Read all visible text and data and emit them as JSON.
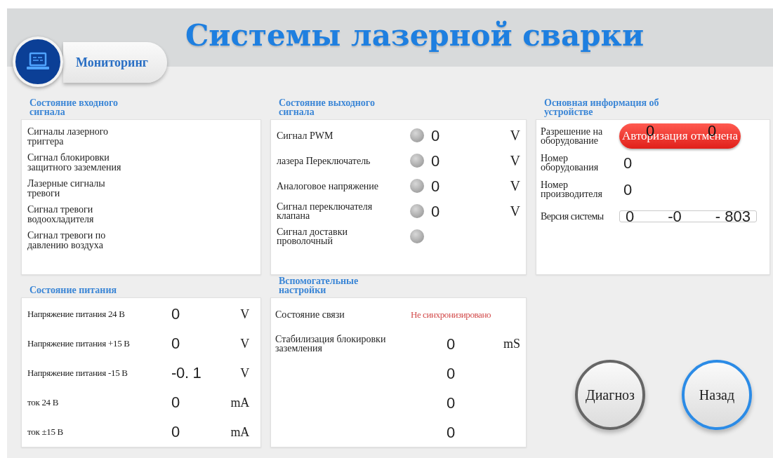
{
  "title": "Системы лазерной сварки",
  "nav": {
    "label": "Мониторинг",
    "selected": true
  },
  "input_signals": {
    "heading": "Состояние входного сигнала",
    "rows": [
      {
        "label": "Сигналы лазерного триггера"
      },
      {
        "label": "Сигнал блокировки защитного заземления"
      },
      {
        "label": "Лазерные сигналы тревоги"
      },
      {
        "label": "Сигнал тревоги водоохладителя"
      },
      {
        "label": "Сигнал тревоги по давлению воздуха"
      }
    ]
  },
  "output_signals": {
    "heading": "Состояние выходного сигнала",
    "rows": [
      {
        "label": "Сигнал PWM",
        "on": false,
        "value": "0",
        "unit": "V"
      },
      {
        "label": "лазера Переключатель",
        "on": false,
        "value": "0",
        "unit": "V"
      },
      {
        "label": "Аналоговое напряжение",
        "on": false,
        "value": "0",
        "unit": "V"
      },
      {
        "label": "Сигнал переключателя клапана",
        "on": false,
        "value": "0",
        "unit": "V"
      },
      {
        "label": "Сигнал доставки проволочный",
        "on": false
      }
    ]
  },
  "device_info": {
    "heading": "Основная информация об устройстве",
    "authorization": {
      "label": "Разрешение на оборудование",
      "button": "Авторизация отменена",
      "overlay": [
        "0",
        "0"
      ]
    },
    "equipment_number": {
      "label": "Номер оборудования",
      "value": "0"
    },
    "manufacturer_number": {
      "label": "Номер производителя",
      "value": "0"
    },
    "system_version": {
      "label": "Версия системы",
      "parts": [
        "0",
        "-0",
        "- 803"
      ]
    }
  },
  "power": {
    "heading": "Состояние питания",
    "rows": [
      {
        "label": "Напряжение питания 24 В",
        "value": "0",
        "unit": "V"
      },
      {
        "label": "Напряжение питания +15 В",
        "value": "0",
        "unit": "V"
      },
      {
        "label": "Напряжение питания -15 В",
        "value": "-0. 1",
        "unit": "V"
      },
      {
        "label": "ток 24 В",
        "value": "0",
        "unit": "mA"
      },
      {
        "label": "ток ±15 В",
        "value": "0",
        "unit": "mA"
      }
    ]
  },
  "aux": {
    "heading": "Вспомогательные настройки",
    "rows": [
      {
        "kind": "status",
        "label": "Состояние связи",
        "value": "Не синхронизировано"
      },
      {
        "kind": "value",
        "label": "Стабилизация блокировки заземления",
        "value": "0",
        "unit": "mS"
      },
      {
        "kind": "value",
        "value": "0"
      },
      {
        "kind": "value",
        "value": "0"
      },
      {
        "kind": "value",
        "value": "0"
      }
    ]
  },
  "buttons": [
    {
      "label": "Диагноз",
      "kind": "neutral"
    },
    {
      "label": "Назад",
      "kind": "primary"
    }
  ]
}
